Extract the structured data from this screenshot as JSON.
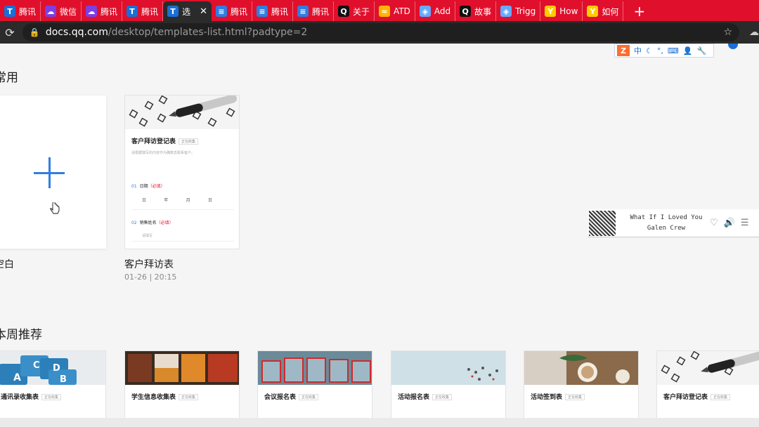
{
  "tabs": [
    {
      "icon": "tencent-docs-icon",
      "label": "腾讯",
      "color": "#1a6fd6",
      "active": false
    },
    {
      "icon": "weiyun-cloud-icon",
      "label": "微信",
      "color": "#7b3fe4",
      "active": false
    },
    {
      "icon": "weiyun-cloud-icon",
      "label": "腾讯",
      "color": "#7b3fe4",
      "active": false
    },
    {
      "icon": "tencent-docs-icon",
      "label": "腾讯",
      "color": "#1a6fd6",
      "active": false
    },
    {
      "icon": "tencent-docs-icon",
      "label": "选",
      "color": "#1a6fd6",
      "active": true
    },
    {
      "icon": "doc-blue-icon",
      "label": "腾讯",
      "color": "#2f7de1",
      "active": false
    },
    {
      "icon": "doc-blue-icon",
      "label": "腾讯",
      "color": "#2f7de1",
      "active": false
    },
    {
      "icon": "doc-blue-icon",
      "label": "腾讯",
      "color": "#2f7de1",
      "active": false
    },
    {
      "icon": "zhihu-q-icon",
      "label": "关于",
      "color": "#111111",
      "active": false
    },
    {
      "icon": "atd-icon",
      "label": "ATD",
      "color": "#ffb400",
      "active": false
    },
    {
      "icon": "shield-icon",
      "label": "Add",
      "color": "#66aaff",
      "active": false
    },
    {
      "icon": "zhihu-q-icon",
      "label": "故事",
      "color": "#111111",
      "active": false
    },
    {
      "icon": "shield-icon",
      "label": "Trigg",
      "color": "#66aaff",
      "active": false
    },
    {
      "icon": "yc-icon",
      "label": "How",
      "color": "#ffcc00",
      "active": false
    },
    {
      "icon": "yc-icon",
      "label": "如何",
      "color": "#ffcc00",
      "active": false
    }
  ],
  "toolbar": {
    "url_host": "docs.qq.com",
    "url_path": "/desktop/templates-list.html?padtype=2"
  },
  "ime": {
    "logo": "Z",
    "mode": "中"
  },
  "sections": {
    "common": "常用",
    "weekly": "本周推荐"
  },
  "blank": {
    "label": "空白"
  },
  "recent": {
    "title": "客户拜访登记表",
    "tag": "正在收集",
    "desc": "请根据填写的内容作为确数去联系客户。",
    "q1": "日期",
    "q1_req": "（必填）",
    "date_parts": [
      "日",
      "年",
      "月",
      "日"
    ],
    "q2": "销售姓名",
    "q2_req": "（必填）",
    "placeholder": "请填写",
    "label": "客户拜访表",
    "time": "01-26 | 20:15"
  },
  "weekly": [
    {
      "title": "通讯录收集表",
      "tag": "正在收集"
    },
    {
      "title": "学生信息收集表",
      "tag": "正在收集"
    },
    {
      "title": "会议报名表",
      "tag": "正在收集"
    },
    {
      "title": "活动报名表",
      "tag": "正在收集"
    },
    {
      "title": "活动签到表",
      "tag": "正在收集"
    },
    {
      "title": "客户拜访登记表",
      "tag": "正在收集"
    }
  ],
  "music": {
    "title": "What If I Loved You",
    "artist": "Galen Crew"
  }
}
